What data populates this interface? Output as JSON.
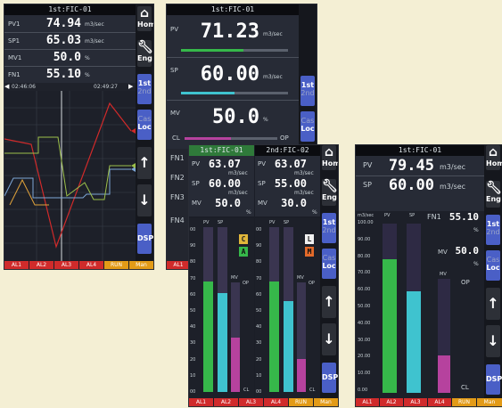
{
  "colors": {
    "pv": "#36b84a",
    "sp": "#3fc3cf",
    "mv": "#b6429e",
    "alarm_red": "#d02b2b",
    "alarm_orange": "#e39b17",
    "nav_blue": "#4a5fc6"
  },
  "icons": [
    "home-icon",
    "wrench-icon",
    "up-arrow-icon",
    "down-arrow-icon"
  ],
  "panel1": {
    "title": "1st:FIC-01",
    "rows": [
      {
        "label": "PV1",
        "value": "74.94",
        "unit": "m3/sec"
      },
      {
        "label": "SP1",
        "value": "65.03",
        "unit": "m3/sec"
      },
      {
        "label": "MV1",
        "value": "50.0",
        "unit": "%"
      },
      {
        "label": "FN1",
        "value": "55.10",
        "unit": "%"
      }
    ],
    "time_start": "02:46:06",
    "time_end": "02:49:27",
    "side": {
      "home": "Home",
      "eng": "Eng",
      "first": "1st",
      "second": "2nd",
      "cas": "Cas",
      "loc": "Loc",
      "dsp": "DSP"
    },
    "alarms": [
      "AL1",
      "AL2",
      "AL3",
      "AL4",
      "RUN",
      "Man"
    ]
  },
  "panel2": {
    "title": "1st:FIC-01",
    "pv_label": "PV",
    "pv_value": "71.23",
    "pv_unit": "m3/sec",
    "sp_label": "SP",
    "sp_value": "60.00",
    "sp_unit": "m3/sec",
    "mv_label": "MV",
    "mv_value": "50.0",
    "mv_unit": "%",
    "cl": "CL",
    "op": "OP",
    "fn": [
      "FN1",
      "FN2",
      "FN3",
      "FN4"
    ],
    "side": {
      "first": "1st",
      "second": "2nd",
      "cas": "Cas",
      "loc": "Loc"
    },
    "alarm": "AL1"
  },
  "panel3": {
    "left": {
      "title": "1st:FIC-01",
      "pv": "63.07",
      "pv_unit": "m3/sec",
      "sp": "60.00",
      "sp_unit": "m3/sec",
      "mv": "50.0",
      "mv_unit": "%",
      "badge1": "C",
      "badge2": "A"
    },
    "right": {
      "title": "2nd:FIC-02",
      "pv": "63.07",
      "pv_unit": "m3/sec",
      "sp": "55.00",
      "sp_unit": "m3/sec",
      "mv": "30.0",
      "mv_unit": "%",
      "badge1": "L",
      "badge2": "M"
    },
    "pv_label": "PV",
    "sp_label": "SP",
    "mv_label": "MV",
    "scale": [
      "00",
      "90",
      "80",
      "70",
      "60",
      "50",
      "40",
      "30",
      "20",
      "10",
      "00"
    ],
    "op": "OP",
    "cl": "CL",
    "bars_left": {
      "pv": 0.67,
      "sp": 0.6,
      "mv": 0.5
    },
    "bars_right": {
      "pv": 0.67,
      "sp": 0.55,
      "mv": 0.3
    },
    "side": {
      "home": "Home",
      "eng": "Eng",
      "first": "1st",
      "second": "2nd",
      "cas": "Cas",
      "loc": "Loc",
      "dsp": "DSP"
    },
    "alarms": [
      "AL1",
      "AL2",
      "AL3",
      "AL4",
      "RUN",
      "Man"
    ]
  },
  "panel4": {
    "title": "1st:FIC-01",
    "pv_label": "PV",
    "pv_value": "79.45",
    "pv_unit": "m3/sec",
    "sp_label": "SP",
    "sp_value": "60.00",
    "sp_unit": "m3/sec",
    "fn_label": "FN1",
    "fn_value": "55.10",
    "fn_unit": "%",
    "mv_label": "MV",
    "mv_value": "50.0",
    "mv_unit": "%",
    "unit_top": "m3/sec",
    "scale": [
      "100.00",
      "90.00",
      "80.00",
      "70.00",
      "60.00",
      "50.00",
      "40.00",
      "30.00",
      "20.00",
      "10.00",
      "0.00"
    ],
    "bar_pv_label": "PV",
    "bar_sp_label": "SP",
    "bar_mv_label": "MV",
    "op": "OP",
    "cl": "CL",
    "bars": {
      "pv": 0.79,
      "sp": 0.6,
      "mv": 0.33
    },
    "side": {
      "home": "Home",
      "eng": "Eng",
      "first": "1st",
      "second": "2nd",
      "cas": "Cas",
      "loc": "Loc",
      "dsp": "DSP"
    },
    "alarms": [
      "AL1",
      "AL2",
      "AL3",
      "AL4",
      "RUN",
      "Man"
    ]
  }
}
